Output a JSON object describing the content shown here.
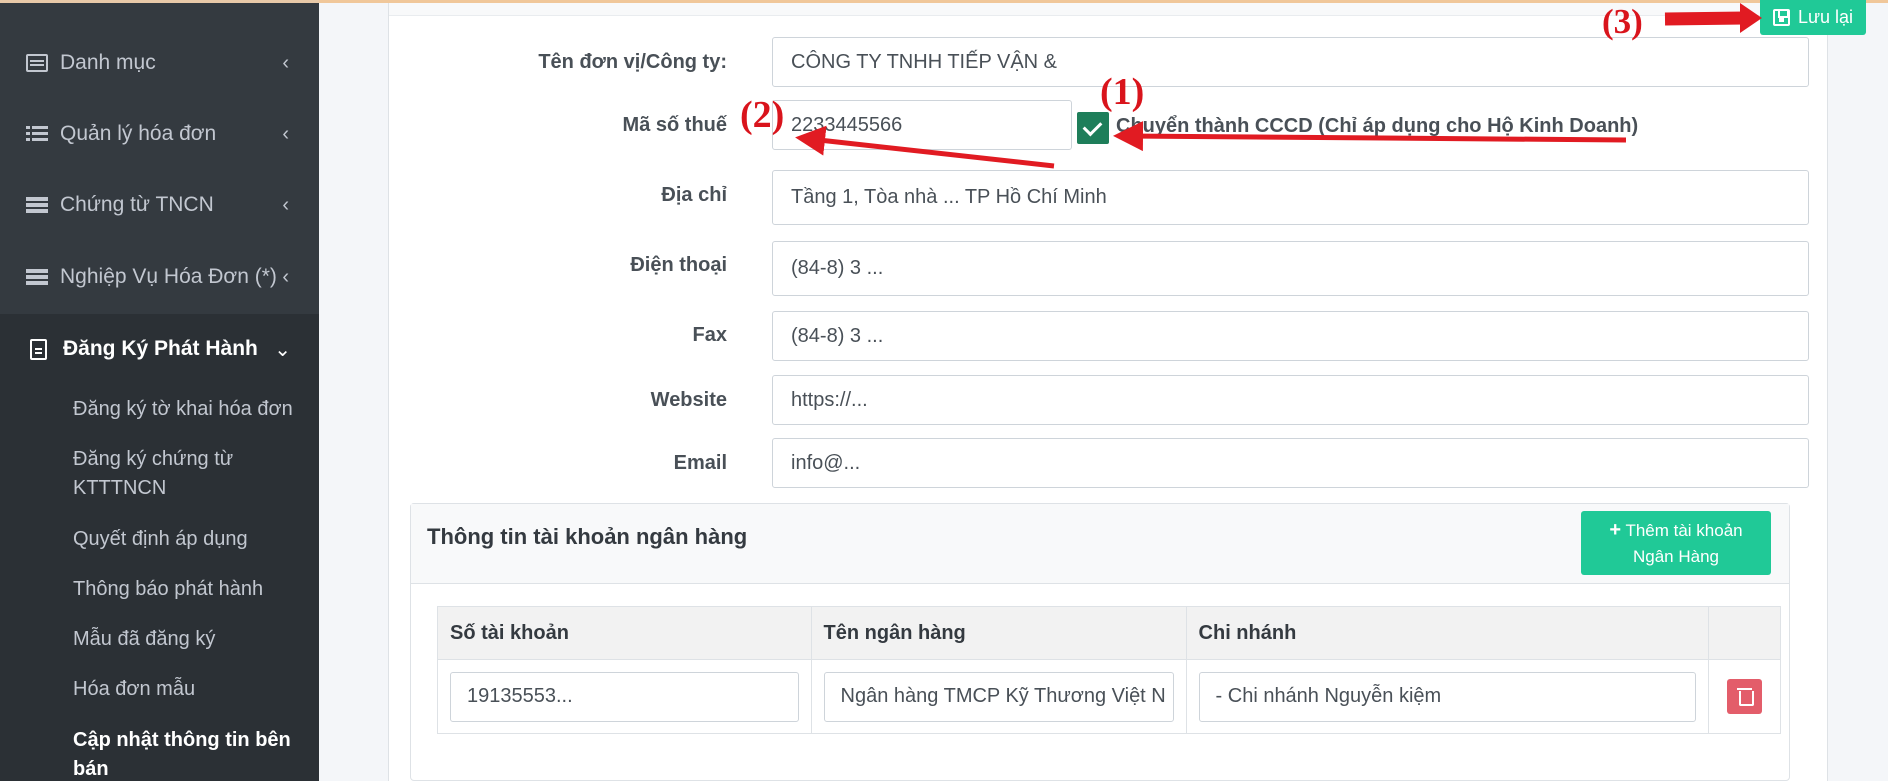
{
  "sidebar": {
    "items": [
      {
        "label": "Danh mục",
        "icon": "grid-icon"
      },
      {
        "label": "Quản lý hóa đơn",
        "icon": "list-icon"
      },
      {
        "label": "Chứng từ TNCN",
        "icon": "server-icon"
      },
      {
        "label": "Nghiệp Vụ Hóa Đơn (*)",
        "icon": "server-icon"
      },
      {
        "label": "Đăng Ký Phát Hành",
        "icon": "document-icon"
      }
    ],
    "submenu": [
      "Đăng ký tờ khai hóa đơn",
      "Đăng ký chứng từ KTTTNCN",
      "Quyết định áp dụng",
      "Thông báo phát hành",
      "Mẫu đã đăng ký",
      "Hóa đơn mẫu",
      "Cập nhật thông tin bên bán"
    ]
  },
  "toolbar": {
    "save_label": "Lưu lại"
  },
  "form": {
    "company_label": "Tên đơn vị/Công ty:",
    "company_value": "CÔNG TY TNHH TIẾP VẬN &",
    "tax_label": "Mã số thuế",
    "tax_value": "2233445566",
    "convert_label": "Chuyển thành CCCD (Chỉ áp dụng cho Hộ Kinh Doanh)",
    "address_label": "Địa chỉ",
    "address_value": "Tầng 1, Tòa nhà ... TP Hồ Chí Minh",
    "phone_label": "Điện thoại",
    "phone_value": "(84-8) 3 ...",
    "fax_label": "Fax",
    "fax_value": "(84-8) 3 ...",
    "website_label": "Website",
    "website_value": "https://...",
    "email_label": "Email",
    "email_value": "info@..."
  },
  "bank": {
    "title": "Thông tin tài khoản ngân hàng",
    "add_label_line1": "Thêm tài khoản",
    "add_label_line2": "Ngân Hàng",
    "columns": [
      "Số tài khoản",
      "Tên ngân hàng",
      "Chi nhánh"
    ],
    "rows": [
      {
        "account": "19135553...",
        "bank_name": "Ngân hàng TMCP Kỹ Thương Việt N",
        "branch": "- Chi nhánh Nguyễn kiệm"
      }
    ]
  },
  "annotations": {
    "one": "(1)",
    "two": "(2)",
    "three": "(3)",
    "color": "#d9141c"
  },
  "colors": {
    "sidebar": "#343a40",
    "accent": "#20c997",
    "checkbox": "#1e7e5a",
    "delete": "#e35d6a"
  }
}
